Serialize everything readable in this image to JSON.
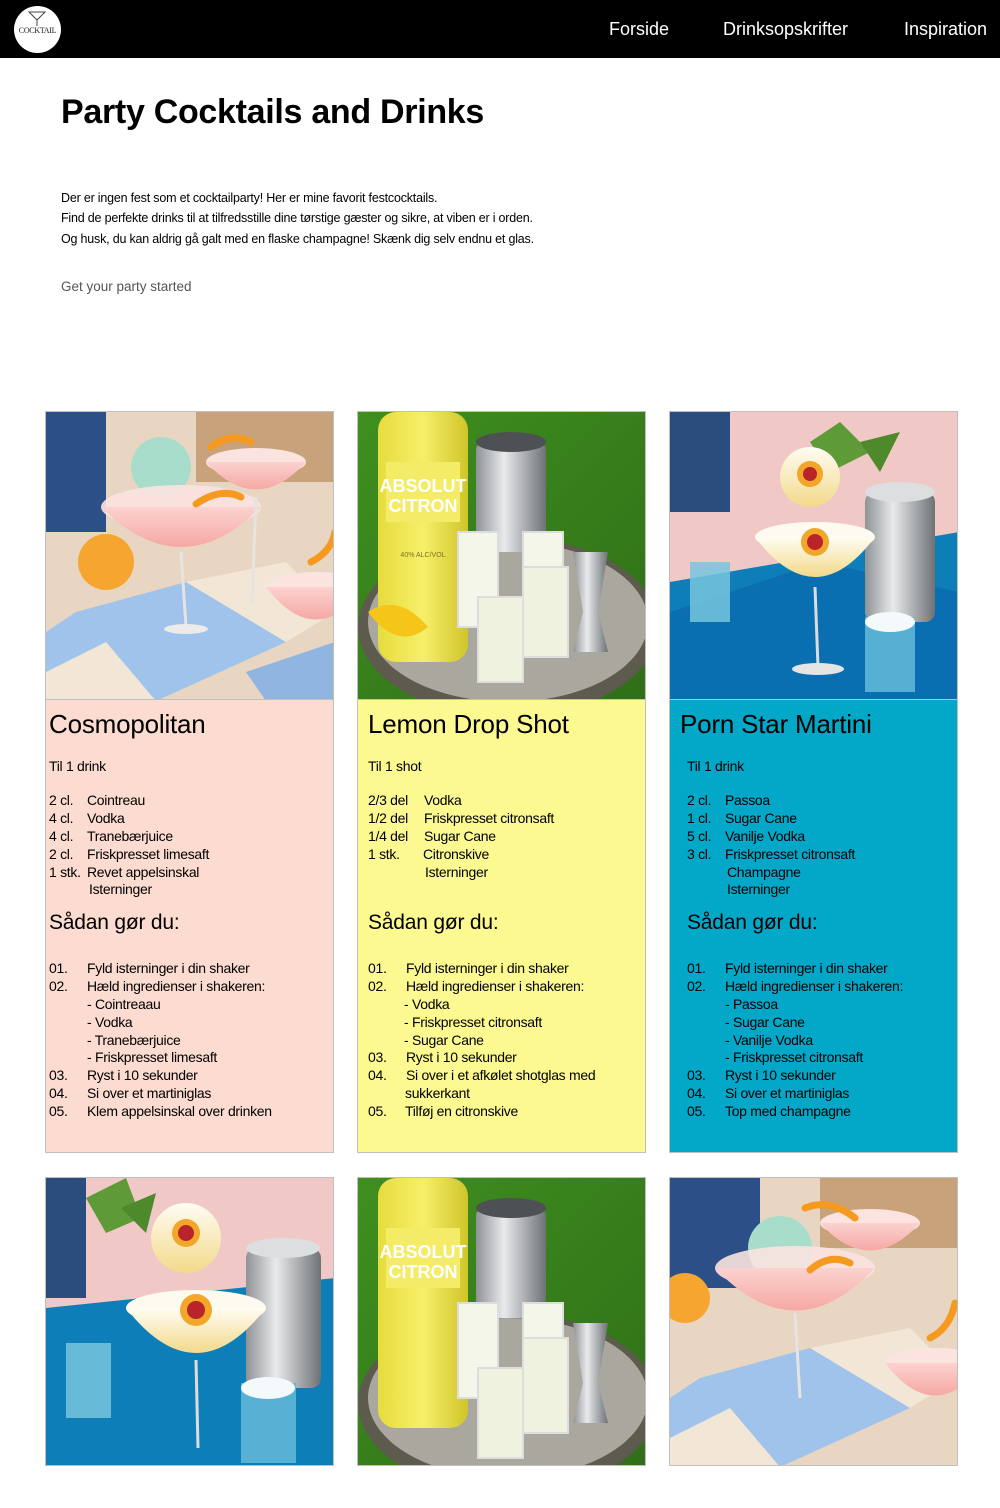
{
  "nav": {
    "logo_text": "COCKTAIL",
    "links": [
      "Forside",
      "Drinksopskrifter",
      "Inspiration"
    ]
  },
  "page": {
    "title": "Party Cocktails and Drinks",
    "intro": [
      "Der er ingen fest som et cocktailparty! Her er mine favorit festcocktails.",
      "Find de perfekte drinks til at tilfredsstille dine tørstige gæster og sikre, at viben er i orden.",
      "Og husk, du kan aldrig gå galt med en flaske champagne! Skænk dig selv endnu et glas."
    ],
    "tagline": "Get your party started"
  },
  "cards": [
    {
      "title": "Cosmopolitan",
      "color": "#fcdbd0",
      "serves": "Til 1 drink",
      "ingredients": [
        {
          "amount": "2 cl.",
          "name": "Cointreau"
        },
        {
          "amount": "4 cl.",
          "name": "Vodka"
        },
        {
          "amount": "4 cl.",
          "name": "Tranebærjuice"
        },
        {
          "amount": "2 cl.",
          "name": "Friskpresset limesaft"
        },
        {
          "amount": "1 stk.",
          "name": "Revet appelsinskal"
        },
        {
          "amount": "",
          "name": "Isterninger"
        }
      ],
      "how_title": "Sådan gør du:",
      "steps": [
        {
          "num": "01.",
          "text": "Fyld isterninger i din shaker"
        },
        {
          "num": "02.",
          "text": "Hæld ingredienser i shakeren:"
        },
        {
          "num": "",
          "text": "- Cointreaau"
        },
        {
          "num": "",
          "text": "-  Vodka"
        },
        {
          "num": "",
          "text": "-  Tranebærjuice"
        },
        {
          "num": "",
          "text": "-  Friskpresset limesaft"
        },
        {
          "num": "03.",
          "text": "Ryst i 10 sekunder"
        },
        {
          "num": "04.",
          "text": "Si over et martiniglas"
        },
        {
          "num": "05.",
          "text": "Klem appelsinskal over drinken"
        }
      ]
    },
    {
      "title": "Lemon Drop Shot",
      "color": "#fcf991",
      "serves": "Til 1 shot",
      "ingredients": [
        {
          "amount": "2/3 del",
          "name": "Vodka"
        },
        {
          "amount": "1/2 del",
          "name": "Friskpresset citronsaft"
        },
        {
          "amount": "1/4 del",
          "name": "Sugar Cane"
        },
        {
          "amount": "1 stk.",
          "name": "Citronskive"
        },
        {
          "amount": "",
          "name": "Isterninger"
        }
      ],
      "how_title": "Sådan gør du:",
      "steps": [
        {
          "num": "01.",
          "text": "Fyld isterninger i din shaker"
        },
        {
          "num": "02.",
          "text": "Hæld ingredienser i shakeren:"
        },
        {
          "num": "",
          "text": "- Vodka"
        },
        {
          "num": "",
          "text": "-  Friskpresset citronsaft"
        },
        {
          "num": "",
          "text": "-  Sugar Cane"
        },
        {
          "num": "03.",
          "text": "Ryst i 10 sekunder"
        },
        {
          "num": "04.",
          "text": "Si over i et afkølet shotglas med"
        },
        {
          "num": "",
          "text": "sukkerkant"
        },
        {
          "num": "05.",
          "text": "Tilføj en citronskive"
        }
      ]
    },
    {
      "title": "Porn Star Martini",
      "color": "#03a8c9",
      "serves": "Til 1 drink",
      "ingredients": [
        {
          "amount": "2 cl.",
          "name": "Passoa"
        },
        {
          "amount": "1 cl.",
          "name": "Sugar Cane"
        },
        {
          "amount": "5 cl.",
          "name": "Vanilje Vodka"
        },
        {
          "amount": "3 cl.",
          "name": "Friskpresset citronsaft"
        },
        {
          "amount": "",
          "name": "Champagne"
        },
        {
          "amount": "",
          "name": "Isterninger"
        }
      ],
      "how_title": "Sådan gør du:",
      "steps": [
        {
          "num": "01.",
          "text": "Fyld isterninger i din shaker"
        },
        {
          "num": "02.",
          "text": "Hæld ingredienser i shakeren:"
        },
        {
          "num": "",
          "text": "-  Passoa"
        },
        {
          "num": "",
          "text": "-  Sugar Cane"
        },
        {
          "num": "",
          "text": "-  Vanilje Vodka"
        },
        {
          "num": "",
          "text": "-  Friskpresset citronsaft"
        },
        {
          "num": "03.",
          "text": "Ryst i 10 sekunder"
        },
        {
          "num": "04.",
          "text": "Si over et martiniglas"
        },
        {
          "num": "05.",
          "text": "Top med champagne"
        }
      ]
    }
  ],
  "photos": {
    "bottle_label_1": "ABSOLUT",
    "bottle_label_2": "CITRON",
    "bottle_small": "40% ALC/VOL"
  }
}
